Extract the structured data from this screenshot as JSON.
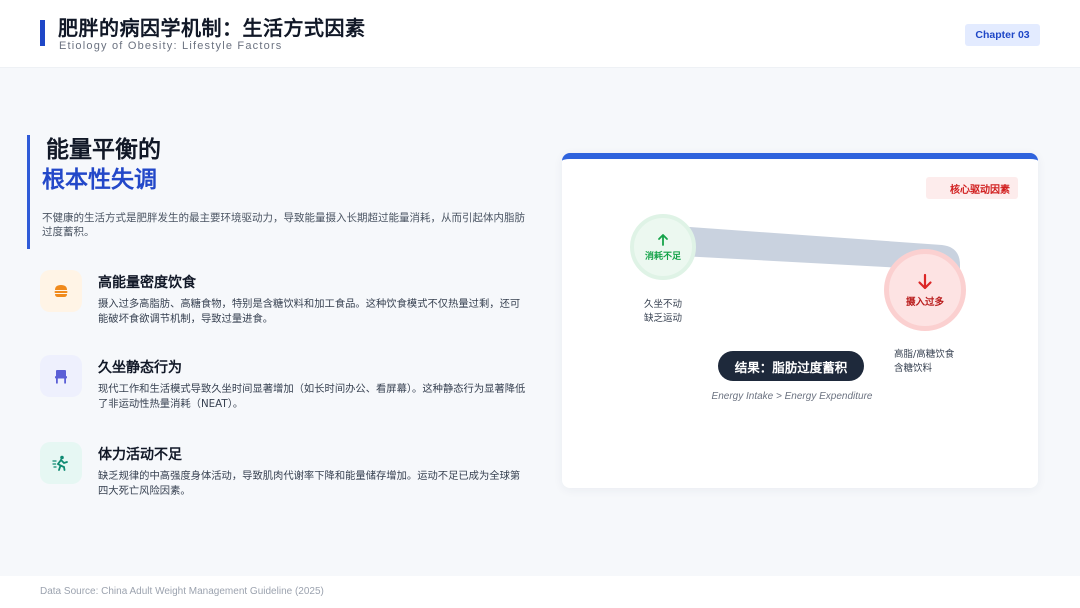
{
  "header": {
    "title": "肥胖的病因学机制：生活方式因素",
    "subtitle": "Etiology of Obesity: Lifestyle Factors",
    "chapter": "Chapter 03",
    "accent": "#1f47c7"
  },
  "intro": {
    "heading_line1": "能量平衡的",
    "heading_line2": "根本性失调",
    "text": "不健康的生活方式是肥胖发生的最主要环境驱动力，导致能量摄入长期超过能量消耗，从而引起体内脂肪过度蓄积。"
  },
  "factors": [
    {
      "icon": "burger-icon",
      "title": "高能量密度饮食",
      "desc": "摄入过多高脂肪、高糖食物，特别是含糖饮料和加工食品。这种饮食模式不仅热量过剩，还可能破坏食欲调节机制，导致过量进食。"
    },
    {
      "icon": "chair-icon",
      "title": "久坐静态行为",
      "desc": "现代工作和生活模式导致久坐时间显著增加（如长时间办公、看屏幕）。这种静态行为显著降低了非运动性热量消耗（NEAT）。"
    },
    {
      "icon": "running-icon",
      "title": "体力活动不足",
      "desc": "缺乏规律的中高强度身体活动，导致肌肉代谢率下降和能量储存增加。运动不足已成为全球第四大死亡风险因素。"
    }
  ],
  "diagram": {
    "badge": "核心驱动因素",
    "consume_label": "消耗不足",
    "consume_note_1": "久坐不动",
    "consume_note_2": "缺乏运动",
    "intake_label": "摄入过多",
    "intake_note_1": "高脂/高糖饮食",
    "intake_note_2": "含糖饮料",
    "result": "结果：脂肪过度蓄积",
    "equation": "Energy Intake > Energy Expenditure",
    "colors": {
      "consume": "#16a34a",
      "intake": "#dc2626",
      "card_top": "#2f63dd",
      "result_bg": "#1e293b"
    }
  },
  "footer": {
    "source": "Data Source: China Adult Weight Management Guideline (2025)"
  }
}
